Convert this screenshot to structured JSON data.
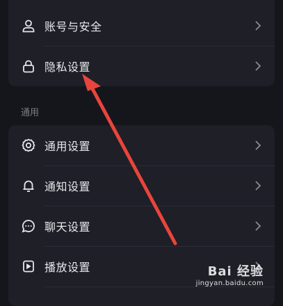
{
  "account": {
    "items": [
      {
        "label": "账号与安全",
        "icon": "user-icon"
      },
      {
        "label": "隐私设置",
        "icon": "lock-icon"
      }
    ]
  },
  "general": {
    "section_title": "通用",
    "items": [
      {
        "label": "通用设置",
        "icon": "gear-icon"
      },
      {
        "label": "通知设置",
        "icon": "bell-icon"
      },
      {
        "label": "聊天设置",
        "icon": "chat-bubble-icon"
      },
      {
        "label": "播放设置",
        "icon": "play-icon"
      }
    ]
  },
  "watermark": {
    "brand": "Bai 经验",
    "url": "jingyan.baidu.com"
  },
  "colors": {
    "background": "#15161c",
    "card": "#1e1f27",
    "annotation_arrow": "#e8453c"
  }
}
